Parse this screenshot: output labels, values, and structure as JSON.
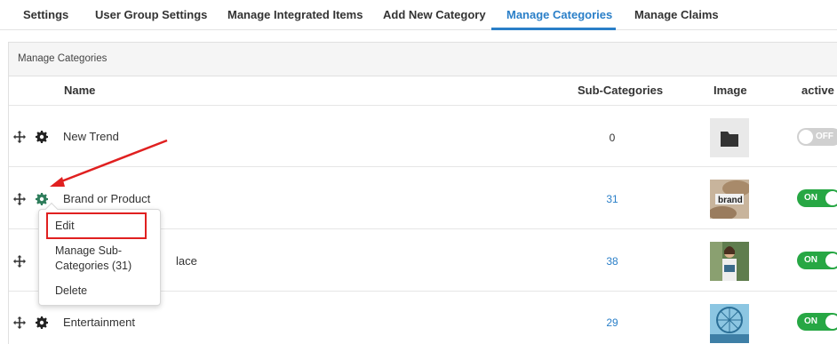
{
  "tabs": [
    {
      "label": "Settings"
    },
    {
      "label": "User Group Settings"
    },
    {
      "label": "Manage Integrated Items"
    },
    {
      "label": "Add New Category"
    },
    {
      "label": "Manage Categories",
      "active": true
    },
    {
      "label": "Manage Claims"
    }
  ],
  "panel": {
    "title": "Manage Categories",
    "columns": {
      "name": "Name",
      "subcategories": "Sub-Categories",
      "image": "Image",
      "active": "active"
    }
  },
  "rows": [
    {
      "name": "New Trend",
      "subcategories": "0",
      "image": "folder-icon",
      "active": false,
      "toggle_label": "OFF"
    },
    {
      "name": "Brand or Product",
      "subcategories": "31",
      "image": "brand-photo",
      "active": true,
      "toggle_label": "ON"
    },
    {
      "name": "lace",
      "subcategories": "38",
      "image": "woman-photo",
      "active": true,
      "toggle_label": "ON"
    },
    {
      "name": "Entertainment",
      "subcategories": "29",
      "image": "ferris-wheel-photo",
      "active": true,
      "toggle_label": "ON"
    }
  ],
  "menu": {
    "edit": "Edit",
    "manage_sub_line1": "Manage Sub-",
    "manage_sub_line2": "Categories (31)",
    "delete": "Delete"
  },
  "colors": {
    "accent": "#2a7fc8",
    "toggle_on": "#27a744",
    "toggle_off": "#d0d0d0",
    "gear_active": "#2e7d5b",
    "highlight": "#e02020"
  }
}
